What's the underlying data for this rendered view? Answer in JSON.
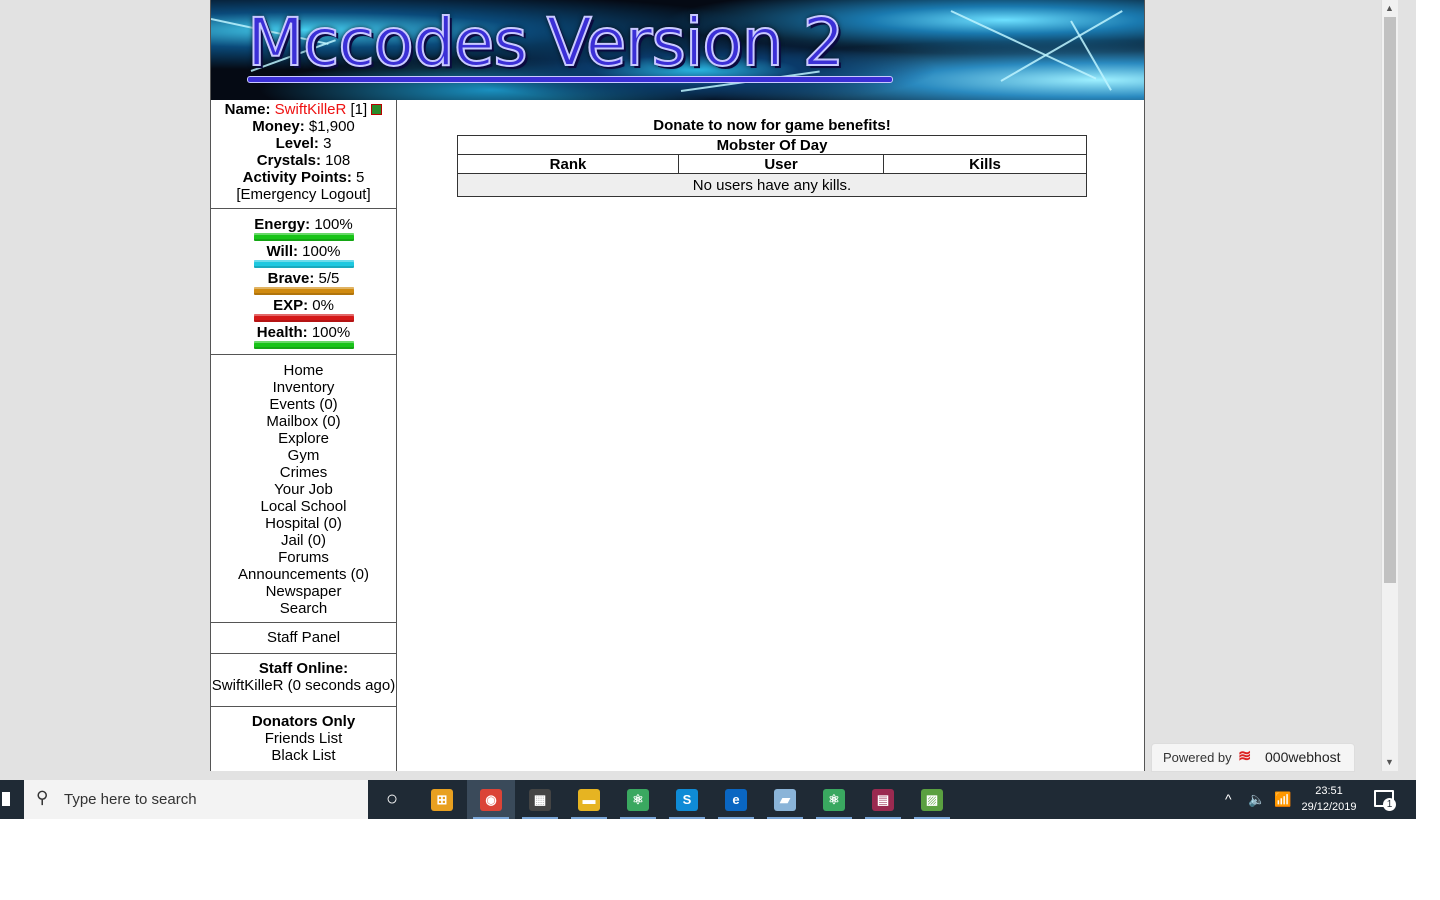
{
  "banner": {
    "title": "Mccodes Version 2"
  },
  "user": {
    "name_label": "Name:",
    "name": "SwiftKilleR",
    "id": "[1]",
    "money_label": "Money:",
    "money": "$1,900",
    "level_label": "Level:",
    "level": "3",
    "crystals_label": "Crystals:",
    "crystals": "108",
    "activity_label": "Activity Points:",
    "activity": "5",
    "logout": "[Emergency Logout]"
  },
  "bars": [
    {
      "label": "Energy:",
      "value": "100%",
      "fill": 1.0,
      "color": "#18c418"
    },
    {
      "label": "Will:",
      "value": "100%",
      "fill": 1.0,
      "color": "#1ec8e0"
    },
    {
      "label": "Brave:",
      "value": "5/5",
      "fill": 1.0,
      "color": "#d08a10"
    },
    {
      "label": "EXP:",
      "value": "0%",
      "fill": 0.0,
      "color": "#d41818"
    },
    {
      "label": "Health:",
      "value": "100%",
      "fill": 1.0,
      "color": "#18c418"
    }
  ],
  "nav": [
    "Home",
    "Inventory",
    "Events (0)",
    "Mailbox (0)",
    "Explore",
    "Gym",
    "Crimes",
    "Your Job",
    "Local School",
    "Hospital (0)",
    "Jail (0)",
    "Forums",
    "Announcements (0)",
    "Newspaper",
    "Search"
  ],
  "staff_panel": "Staff Panel",
  "staff_online": {
    "title": "Staff Online:",
    "entry": "SwiftKilleR (0 seconds ago)"
  },
  "donators": {
    "title": "Donators Only",
    "links": [
      "Friends List",
      "Black List"
    ]
  },
  "main": {
    "headline": "Donate to now for game benefits!",
    "table_title": "Mobster Of Day",
    "columns": [
      "Rank",
      "User",
      "Kills"
    ],
    "empty": "No users have any kills."
  },
  "powered": {
    "label": "Powered by",
    "brand": "000webhost"
  },
  "taskbar": {
    "search_placeholder": "Type here to search",
    "time": "23:51",
    "date": "29/12/2019",
    "notifications": "1",
    "icons": [
      {
        "name": "task-view-icon",
        "glyph": "○",
        "bg": "transparent"
      },
      {
        "name": "store-icon",
        "glyph": "⊞",
        "bg": "#e8a020"
      },
      {
        "name": "chrome-icon",
        "glyph": "◉",
        "bg": "#db4437"
      },
      {
        "name": "calculator-icon",
        "glyph": "▦",
        "bg": "#444"
      },
      {
        "name": "file-explorer-icon",
        "glyph": "▬",
        "bg": "#e6b422"
      },
      {
        "name": "atom-icon",
        "glyph": "⚛",
        "bg": "#3aa860"
      },
      {
        "name": "skype-icon",
        "glyph": "S",
        "bg": "#0f8bd6"
      },
      {
        "name": "edge-icon",
        "glyph": "e",
        "bg": "#0a66c2"
      },
      {
        "name": "notepad-icon",
        "glyph": "▰",
        "bg": "#8ab4d8"
      },
      {
        "name": "atom-icon-2",
        "glyph": "⚛",
        "bg": "#3aa860"
      },
      {
        "name": "winrar-icon",
        "glyph": "▤",
        "bg": "#9a2a50"
      },
      {
        "name": "task-manager-icon",
        "glyph": "▨",
        "bg": "#5aa040"
      }
    ]
  }
}
